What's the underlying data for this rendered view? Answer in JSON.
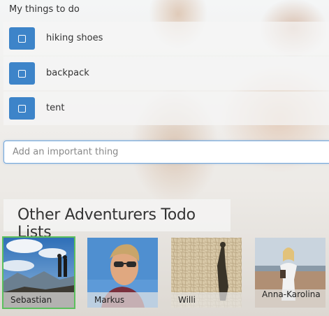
{
  "list": {
    "title": "My things to do",
    "items": [
      {
        "label": "hiking shoes"
      },
      {
        "label": "backpack"
      },
      {
        "label": "tent"
      }
    ]
  },
  "add": {
    "placeholder": "Add an important thing"
  },
  "others": {
    "title": "Other Adventurers Todo Lists",
    "people": [
      {
        "name": "Sebastian",
        "selected": true
      },
      {
        "name": "Markus"
      },
      {
        "name": "Willi"
      },
      {
        "name": "Anna-Karolina"
      }
    ]
  },
  "colors": {
    "checkbox_blue": "#3d84c9",
    "selected_green": "#5cbf5c",
    "input_border": "#6fa6dc"
  }
}
